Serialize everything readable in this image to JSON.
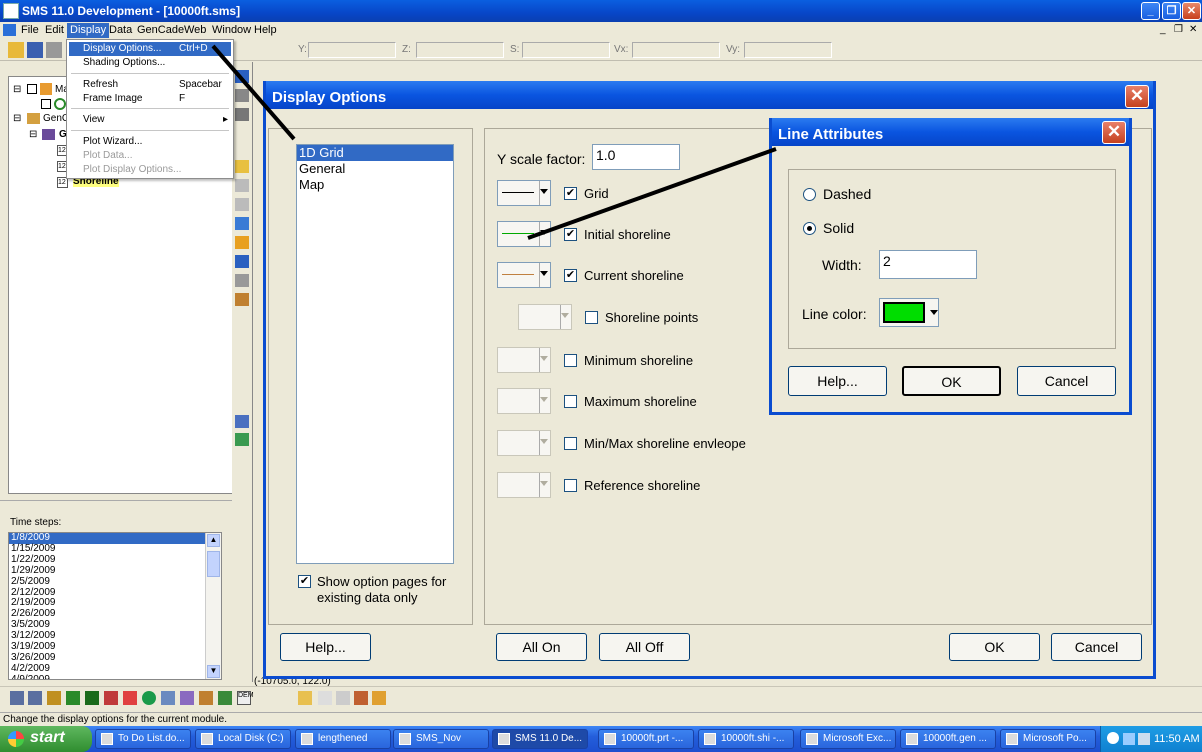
{
  "window": {
    "title": "SMS 11.0 Development - [10000ft.sms]"
  },
  "menubar": {
    "items": [
      "File",
      "Edit",
      "Display",
      "Data",
      "GenCade",
      "Web",
      "Window",
      "Help"
    ]
  },
  "display_menu": {
    "items": [
      {
        "label": "Display Options...",
        "shortcut": "Ctrl+D"
      },
      {
        "label": "Shading Options...",
        "shortcut": ""
      },
      {
        "label": "Refresh",
        "shortcut": "Spacebar"
      },
      {
        "label": "Frame Image",
        "shortcut": "F"
      },
      {
        "label": "View",
        "shortcut": ""
      },
      {
        "label": "Plot Wizard...",
        "shortcut": ""
      },
      {
        "label": "Plot Data...",
        "shortcut": ""
      },
      {
        "label": "Plot Display Options...",
        "shortcut": ""
      }
    ]
  },
  "toolbar": {
    "coord_labels": [
      "Y:",
      "Z:",
      "S:",
      "Vx:",
      "Vy:"
    ]
  },
  "tree": {
    "items": [
      "Ma",
      "GenC",
      "G",
      "Shoreline"
    ],
    "icon_labels": [
      "12",
      "12",
      "12"
    ]
  },
  "timesteps": {
    "label": "Time steps:",
    "items": [
      "1/8/2009",
      "1/15/2009",
      "1/22/2009",
      "1/29/2009",
      "2/5/2009",
      "2/12/2009",
      "2/19/2009",
      "2/26/2009",
      "3/5/2009",
      "3/12/2009",
      "3/19/2009",
      "3/26/2009",
      "4/2/2009",
      "4/9/2009"
    ]
  },
  "coord_readout": "(-10705.0, 122.0)",
  "status": "Change the display options for the current module.",
  "display_options": {
    "title": "Display Options",
    "list": [
      "1D Grid",
      "General",
      "Map"
    ],
    "show_pages_label": "Show option pages for existing data only",
    "y_scale_label": "Y scale factor:",
    "y_scale_value": "1.0",
    "rows": [
      {
        "label": "Grid",
        "checked": "✔",
        "line_color": "#000000"
      },
      {
        "label": "Initial shoreline",
        "checked": "✔",
        "line_color": "#00aa00"
      },
      {
        "label": "Current shoreline",
        "checked": "✔",
        "line_color": "#c08040"
      },
      {
        "label": "Shoreline points",
        "checked": "",
        "line_color": ""
      },
      {
        "label": "Minimum shoreline",
        "checked": "",
        "line_color": ""
      },
      {
        "label": "Maximum shoreline",
        "checked": "",
        "line_color": ""
      },
      {
        "label": "Min/Max shoreline envleope",
        "checked": "",
        "line_color": ""
      },
      {
        "label": "Reference shoreline",
        "checked": "",
        "line_color": ""
      }
    ],
    "help": "Help...",
    "all_on": "All On",
    "all_off": "All Off",
    "ok": "OK",
    "cancel": "Cancel"
  },
  "line_attributes": {
    "title": "Line Attributes",
    "dashed": "Dashed",
    "solid": "Solid",
    "width_label": "Width:",
    "width_value": "2",
    "color_label": "Line color:",
    "color": "#00dd00",
    "help": "Help...",
    "ok": "OK",
    "cancel": "Cancel"
  },
  "taskbar": {
    "start": "start",
    "tasks": [
      "To Do List.do...",
      "Local Disk (C:)",
      "lengthened",
      "SMS_Nov",
      "SMS 11.0 De...",
      "10000ft.prt -...",
      "10000ft.shi -...",
      "Microsoft Exc...",
      "10000ft.gen ...",
      "Microsoft Po..."
    ],
    "clock": "11:50 AM"
  }
}
